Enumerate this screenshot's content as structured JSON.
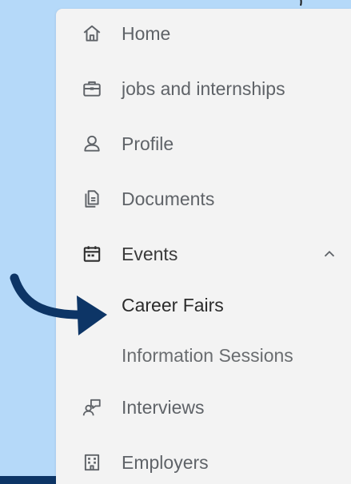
{
  "nav": {
    "items": [
      {
        "label": "Home",
        "icon": "home-icon"
      },
      {
        "label": "jobs and internships",
        "icon": "briefcase-icon"
      },
      {
        "label": "Profile",
        "icon": "person-icon"
      },
      {
        "label": "Documents",
        "icon": "documents-icon"
      },
      {
        "label": "Events",
        "icon": "calendar-icon",
        "expanded": true
      },
      {
        "label": "Interviews",
        "icon": "interviews-icon"
      },
      {
        "label": "Employers",
        "icon": "building-icon"
      }
    ],
    "events_subitems": [
      {
        "label": "Career Fairs",
        "active": true
      },
      {
        "label": "Information Sessions",
        "active": false
      }
    ]
  },
  "colors": {
    "background": "#b5d9f9",
    "sidebar": "#f3f3f3",
    "arrow": "#0d3566",
    "text": "#5f6368",
    "active_text": "#2b2b2b"
  }
}
